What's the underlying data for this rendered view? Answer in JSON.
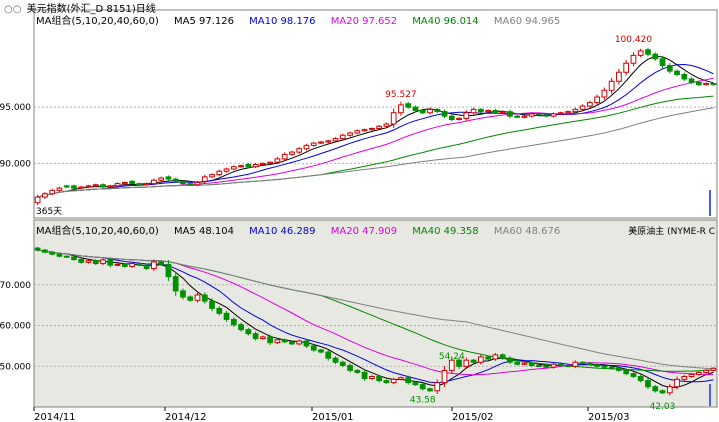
{
  "header": {
    "icon": "dual-circle-icon",
    "title": "美元指数(外汇_D 8151)日线"
  },
  "top_panel": {
    "ma_title": "MA组合(5,10,20,40,60,0)",
    "ma5": "MA5 97.126",
    "ma10": "MA10 98.176",
    "ma20": "MA20 97.652",
    "ma40": "MA40 96.014",
    "ma60": "MA60 94.965",
    "corner_label": "365天"
  },
  "bottom_panel": {
    "ma_title": "MA组合(5,10,20,40,60,0)",
    "ma5": "MA5 48.104",
    "ma10": "MA10 46.289",
    "ma20": "MA20 47.909",
    "ma40": "MA40 49.358",
    "ma60": "MA60 48.676",
    "right_label": "美原油主 (NYME-R C"
  },
  "colors": {
    "up": "#d40000",
    "down": "#009000",
    "ma5": "#000000",
    "ma10": "#0000e0",
    "ma20": "#e000e0",
    "ma40": "#008800",
    "ma60": "#808080",
    "panel_bg": "#e8e8e2",
    "grid": "#b0b0b0"
  },
  "chart_data": [
    {
      "type": "candlestick",
      "title": "美元指数(外汇_D 8151)日线",
      "ylim": [
        85.5,
        101.5
      ],
      "y_ticks": [
        "95.000",
        "90.000"
      ],
      "annotations": [
        {
          "label": "100.420",
          "x": 82,
          "y": 100.42
        },
        {
          "label": "95.527",
          "x": 50,
          "y": 95.527
        }
      ],
      "closes": [
        87.0,
        87.3,
        87.6,
        87.8,
        87.9,
        87.8,
        87.9,
        88.0,
        88.1,
        87.9,
        88.0,
        88.2,
        88.3,
        88.2,
        88.1,
        88.2,
        88.5,
        88.7,
        88.6,
        88.4,
        88.2,
        88.1,
        88.3,
        88.8,
        89.0,
        89.3,
        89.5,
        89.7,
        89.8,
        89.7,
        89.9,
        90.0,
        90.1,
        90.4,
        90.8,
        91.0,
        91.3,
        91.6,
        91.8,
        91.9,
        92.0,
        92.2,
        92.5,
        92.7,
        92.9,
        93.0,
        93.1,
        93.3,
        93.5,
        94.5,
        95.2,
        95.0,
        94.7,
        94.5,
        94.8,
        94.6,
        94.2,
        93.9,
        94.0,
        94.5,
        94.8,
        94.6,
        94.7,
        94.5,
        94.6,
        94.2,
        94.1,
        94.2,
        94.4,
        94.3,
        94.2,
        94.4,
        94.5,
        94.6,
        94.8,
        95.1,
        95.4,
        95.9,
        96.5,
        97.3,
        98.1,
        98.9,
        99.6,
        100.0,
        99.7,
        99.3,
        98.7,
        98.2,
        97.9,
        97.5,
        97.2,
        97.0,
        97.1,
        97.0
      ],
      "opens": [
        86.5,
        87.0,
        87.3,
        87.6,
        88.0,
        88.0,
        87.8,
        87.9,
        88.0,
        88.1,
        87.9,
        88.0,
        88.2,
        88.4,
        88.2,
        88.1,
        88.2,
        88.5,
        88.8,
        88.6,
        88.4,
        88.2,
        88.1,
        88.4,
        88.8,
        89.0,
        89.3,
        89.5,
        89.7,
        89.9,
        89.7,
        89.9,
        90.0,
        90.1,
        90.4,
        90.8,
        91.0,
        91.3,
        91.6,
        91.8,
        91.9,
        92.0,
        92.2,
        92.5,
        92.7,
        92.9,
        93.0,
        93.1,
        93.3,
        93.5,
        94.5,
        95.3,
        95.0,
        94.7,
        94.5,
        94.8,
        94.6,
        94.2,
        93.9,
        94.0,
        94.5,
        94.8,
        94.6,
        94.7,
        94.5,
        94.6,
        94.2,
        94.1,
        94.2,
        94.4,
        94.3,
        94.2,
        94.4,
        94.5,
        94.6,
        94.8,
        95.1,
        95.4,
        95.9,
        96.5,
        97.3,
        98.1,
        98.9,
        99.6,
        100.1,
        99.7,
        99.3,
        98.7,
        98.2,
        97.9,
        97.5,
        97.2,
        97.0,
        97.1
      ]
    },
    {
      "type": "candlestick",
      "title": "美原油主 (NYME-R C",
      "ylim": [
        41,
        80
      ],
      "y_ticks": [
        "70.000",
        "60.000",
        "50.000"
      ],
      "x_ticks": [
        "2014/11",
        "2014/12",
        "2015/01",
        "2015/02",
        "2015/03"
      ],
      "annotations": [
        {
          "label": "54.24",
          "x": 57,
          "y": 54.24
        },
        {
          "label": "43.58",
          "x": 53,
          "y": 43.58
        },
        {
          "label": "42.03",
          "x": 86,
          "y": 42.03
        }
      ],
      "closes": [
        78.5,
        78.0,
        77.5,
        77.0,
        76.8,
        76.2,
        75.5,
        75.9,
        75.2,
        76.1,
        74.8,
        75.0,
        74.5,
        75.2,
        74.8,
        74.0,
        75.6,
        75.0,
        72.0,
        68.5,
        67.0,
        66.2,
        67.5,
        66.0,
        64.2,
        63.0,
        61.5,
        60.2,
        59.0,
        58.0,
        56.8,
        57.2,
        55.8,
        56.5,
        56.0,
        55.5,
        56.2,
        55.0,
        54.0,
        53.5,
        52.0,
        51.0,
        50.2,
        49.0,
        48.5,
        47.0,
        47.5,
        46.5,
        46.0,
        46.8,
        47.2,
        46.0,
        45.5,
        44.5,
        44.0,
        46.0,
        49.0,
        51.5,
        50.0,
        51.5,
        51.0,
        52.3,
        51.8,
        52.8,
        52.0,
        51.0,
        50.5,
        50.8,
        50.2,
        50.0,
        49.8,
        50.5,
        50.2,
        50.0,
        51.0,
        50.8,
        50.4,
        50.0,
        49.8,
        49.5,
        49.0,
        48.2,
        47.5,
        46.5,
        45.0,
        44.0,
        43.5,
        45.0,
        46.8,
        47.5,
        48.0,
        48.5,
        49.0,
        49.5
      ],
      "opens": [
        79.0,
        78.5,
        78.0,
        77.5,
        77.0,
        76.8,
        76.2,
        75.5,
        75.9,
        75.2,
        76.1,
        74.8,
        75.0,
        74.5,
        75.2,
        74.8,
        74.0,
        75.6,
        75.0,
        72.0,
        68.5,
        67.0,
        66.2,
        67.5,
        66.0,
        64.2,
        63.0,
        61.5,
        60.2,
        59.0,
        58.0,
        56.8,
        57.2,
        55.8,
        56.5,
        56.0,
        55.5,
        56.2,
        55.0,
        54.0,
        53.5,
        52.0,
        51.0,
        50.2,
        49.0,
        48.5,
        47.0,
        47.5,
        46.5,
        46.0,
        46.8,
        47.2,
        46.0,
        45.5,
        44.5,
        44.0,
        46.0,
        49.0,
        51.5,
        50.0,
        51.5,
        51.0,
        52.3,
        51.8,
        52.8,
        52.0,
        51.0,
        50.5,
        50.8,
        50.2,
        50.0,
        49.8,
        50.5,
        50.2,
        50.0,
        51.0,
        50.8,
        50.4,
        50.0,
        49.8,
        49.5,
        49.0,
        48.2,
        47.5,
        46.5,
        45.0,
        44.0,
        43.5,
        45.0,
        46.8,
        47.5,
        48.0,
        48.5,
        49.0
      ]
    }
  ]
}
